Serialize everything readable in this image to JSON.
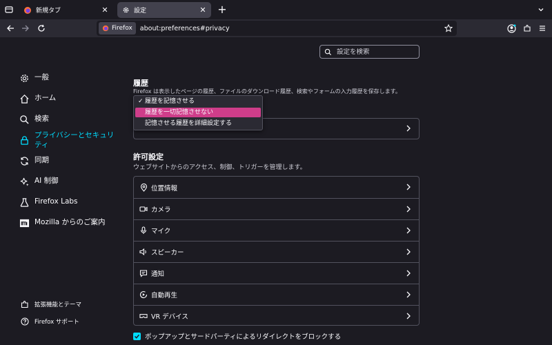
{
  "tabs": [
    {
      "label": "新規タブ",
      "icon": "firefox-icon",
      "active": false
    },
    {
      "label": "設定",
      "icon": "gear-icon",
      "active": true
    }
  ],
  "navbar": {
    "identity_label": "Firefox",
    "url": "about:preferences#privacy"
  },
  "sidebar": {
    "items": [
      {
        "label": "一般",
        "icon": "gear-icon"
      },
      {
        "label": "ホーム",
        "icon": "home-icon"
      },
      {
        "label": "検索",
        "icon": "search-icon"
      },
      {
        "label": "プライバシーとセキュリティ",
        "icon": "lock-icon"
      },
      {
        "label": "同期",
        "icon": "sync-icon"
      },
      {
        "label": "AI 制御",
        "icon": "sparkle-icon"
      },
      {
        "label": "Firefox Labs",
        "icon": "flask-icon"
      },
      {
        "label": "Mozilla からのご案内",
        "icon": "mozilla-icon"
      }
    ],
    "bottom": [
      {
        "label": "拡張機能とテーマ",
        "icon": "puzzle-icon"
      },
      {
        "label": "Firefox サポート",
        "icon": "help-icon"
      }
    ]
  },
  "search": {
    "placeholder": "設定を検索"
  },
  "history": {
    "title": "履歴",
    "description": "Firefox は表示したページの履歴、ファイルのダウンロード履歴、検索やフォームの入力履歴を保存します。",
    "options": [
      "履歴を記憶させる",
      "履歴を一切記憶させない",
      "記憶させる履歴を詳細設定する"
    ],
    "checked_index": 0,
    "highlighted_index": 1
  },
  "permissions": {
    "title": "許可設定",
    "description": "ウェブサイトからのアクセス、制御、トリガーを管理します。",
    "items": [
      {
        "label": "位置情報",
        "icon": "location-icon"
      },
      {
        "label": "カメラ",
        "icon": "camera-icon"
      },
      {
        "label": "マイク",
        "icon": "microphone-icon"
      },
      {
        "label": "スピーカー",
        "icon": "speaker-icon"
      },
      {
        "label": "通知",
        "icon": "notification-icon"
      },
      {
        "label": "自動再生",
        "icon": "autoplay-icon"
      },
      {
        "label": "VR デバイス",
        "icon": "vr-icon"
      }
    ],
    "popup_block_label": "ポップアップとサードパーティによるリダイレクトをブロックする"
  },
  "colors": {
    "accent": "#00ddff",
    "highlight": "#cf3d8a",
    "background": "#1c1b22"
  }
}
